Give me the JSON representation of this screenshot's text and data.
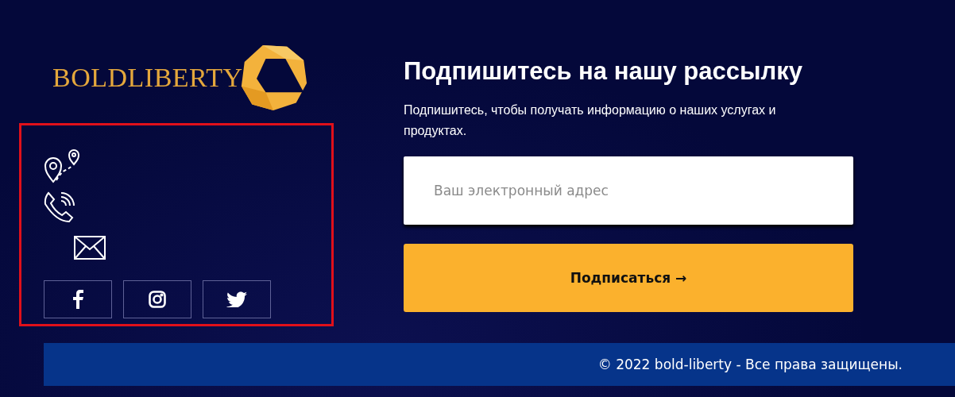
{
  "logo": {
    "text": "BOLDLIBERTY"
  },
  "contacts": [
    {
      "kind": "location"
    },
    {
      "kind": "phone"
    },
    {
      "kind": "email"
    }
  ],
  "social": [
    {
      "kind": "facebook"
    },
    {
      "kind": "instagram"
    },
    {
      "kind": "twitter"
    }
  ],
  "newsletter": {
    "title": "Подпишитесь на нашу рассылку",
    "description": "Подпишитесь, чтобы получать информацию о наших услугах и продуктах.",
    "email": {
      "placeholder": "Ваш электронный адрес"
    },
    "button": "Подписаться →"
  },
  "footer": {
    "copyright": "© 2022 bold-liberty - Все права защищены."
  }
}
